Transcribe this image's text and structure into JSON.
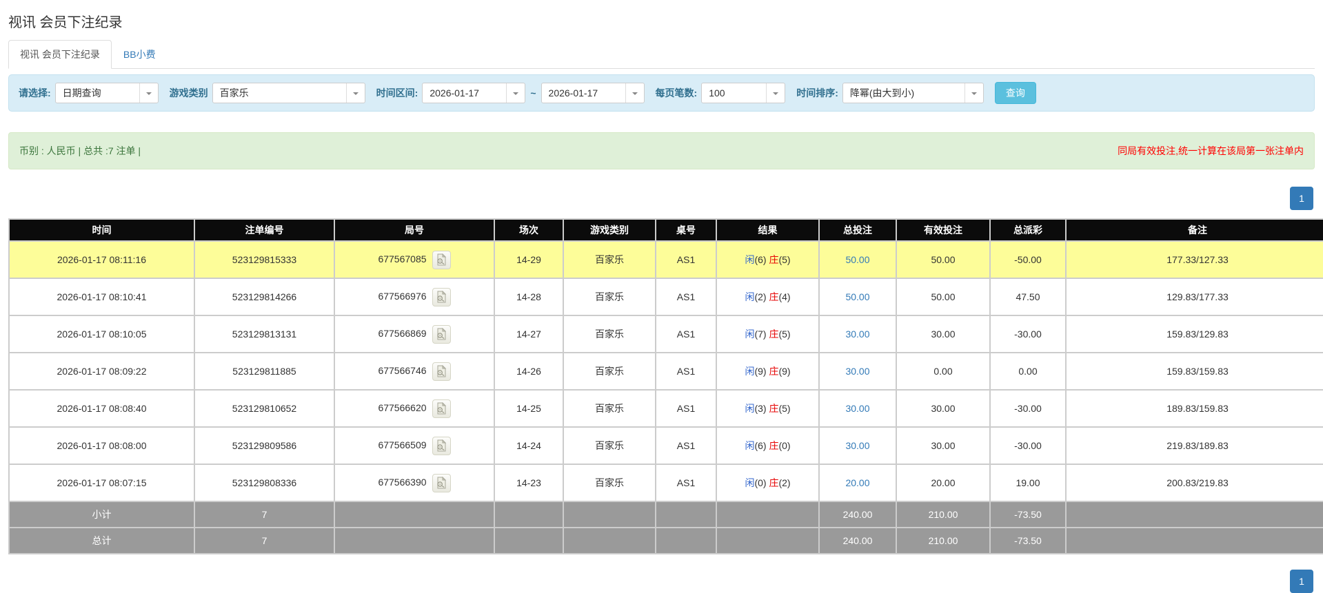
{
  "page_title": "视讯 会员下注纪录",
  "tabs": {
    "active_label": "视讯 会员下注纪录",
    "bb_label": "BB小费"
  },
  "filters": {
    "select_label": "请选择:",
    "select_value": "日期查询",
    "game_type_label": "游戏类别",
    "game_type_value": "百家乐",
    "date_range_label": "时间区间:",
    "date_from": "2026-01-17",
    "date_separator": "~",
    "date_to": "2026-01-17",
    "page_size_label": "每页笔数:",
    "page_size_value": "100",
    "sort_label": "时间排序:",
    "sort_value": "降幂(由大到小)",
    "search_button": "查询"
  },
  "summary": {
    "left": "币别 : 人民币 | 总共 :7 注单 |",
    "right": "同局有效投注,统一计算在该局第一张注单内"
  },
  "pagination": {
    "top": "1",
    "bottom": "1"
  },
  "table": {
    "headers": [
      "时间",
      "注单编号",
      "局号",
      "场次",
      "游戏类别",
      "桌号",
      "结果",
      "总投注",
      "有效投注",
      "总派彩",
      "备注"
    ],
    "rows": [
      {
        "time": "2026-01-17 08:11:16",
        "bet_no": "523129815333",
        "round_no": "677567085",
        "session": "14-29",
        "game": "百家乐",
        "table_no": "AS1",
        "result": {
          "player_label": "闲",
          "player_value": "(6)",
          "banker_label": "庄",
          "banker_value": "(5)"
        },
        "total_bet": "50.00",
        "valid_bet": "50.00",
        "payout": "-50.00",
        "remark": "177.33/127.33",
        "highlight": true
      },
      {
        "time": "2026-01-17 08:10:41",
        "bet_no": "523129814266",
        "round_no": "677566976",
        "session": "14-28",
        "game": "百家乐",
        "table_no": "AS1",
        "result": {
          "player_label": "闲",
          "player_value": "(2)",
          "banker_label": "庄",
          "banker_value": "(4)"
        },
        "total_bet": "50.00",
        "valid_bet": "50.00",
        "payout": "47.50",
        "remark": "129.83/177.33",
        "highlight": false
      },
      {
        "time": "2026-01-17 08:10:05",
        "bet_no": "523129813131",
        "round_no": "677566869",
        "session": "14-27",
        "game": "百家乐",
        "table_no": "AS1",
        "result": {
          "player_label": "闲",
          "player_value": "(7)",
          "banker_label": "庄",
          "banker_value": "(5)"
        },
        "total_bet": "30.00",
        "valid_bet": "30.00",
        "payout": "-30.00",
        "remark": "159.83/129.83",
        "highlight": false
      },
      {
        "time": "2026-01-17 08:09:22",
        "bet_no": "523129811885",
        "round_no": "677566746",
        "session": "14-26",
        "game": "百家乐",
        "table_no": "AS1",
        "result": {
          "player_label": "闲",
          "player_value": "(9)",
          "banker_label": "庄",
          "banker_value": "(9)"
        },
        "total_bet": "30.00",
        "valid_bet": "0.00",
        "payout": "0.00",
        "remark": "159.83/159.83",
        "highlight": false
      },
      {
        "time": "2026-01-17 08:08:40",
        "bet_no": "523129810652",
        "round_no": "677566620",
        "session": "14-25",
        "game": "百家乐",
        "table_no": "AS1",
        "result": {
          "player_label": "闲",
          "player_value": "(3)",
          "banker_label": "庄",
          "banker_value": "(5)"
        },
        "total_bet": "30.00",
        "valid_bet": "30.00",
        "payout": "-30.00",
        "remark": "189.83/159.83",
        "highlight": false
      },
      {
        "time": "2026-01-17 08:08:00",
        "bet_no": "523129809586",
        "round_no": "677566509",
        "session": "14-24",
        "game": "百家乐",
        "table_no": "AS1",
        "result": {
          "player_label": "闲",
          "player_value": "(6)",
          "banker_label": "庄",
          "banker_value": "(0)"
        },
        "total_bet": "30.00",
        "valid_bet": "30.00",
        "payout": "-30.00",
        "remark": "219.83/189.83",
        "highlight": false
      },
      {
        "time": "2026-01-17 08:07:15",
        "bet_no": "523129808336",
        "round_no": "677566390",
        "session": "14-23",
        "game": "百家乐",
        "table_no": "AS1",
        "result": {
          "player_label": "闲",
          "player_value": "(0)",
          "banker_label": "庄",
          "banker_value": "(2)"
        },
        "total_bet": "20.00",
        "valid_bet": "20.00",
        "payout": "19.00",
        "remark": "200.83/219.83",
        "highlight": false
      }
    ],
    "footers": [
      {
        "label": "小计",
        "count": "7",
        "total_bet": "240.00",
        "valid_bet": "210.00",
        "payout": "-73.50"
      },
      {
        "label": "总计",
        "count": "7",
        "total_bet": "240.00",
        "valid_bet": "210.00",
        "payout": "-73.50"
      }
    ]
  },
  "colors": {
    "accent_blue": "#337ab7",
    "search_button_blue": "#5bc0de",
    "negative_red": "#ff0000",
    "player_blue": "#3366cc",
    "banker_red": "#e60000",
    "highlight_yellow": "#fdfd99",
    "header_black": "#0b0b0b",
    "footer_gray": "#9a9a9a",
    "filter_bg": "#d9edf7",
    "summary_bg": "#dff0d8"
  }
}
